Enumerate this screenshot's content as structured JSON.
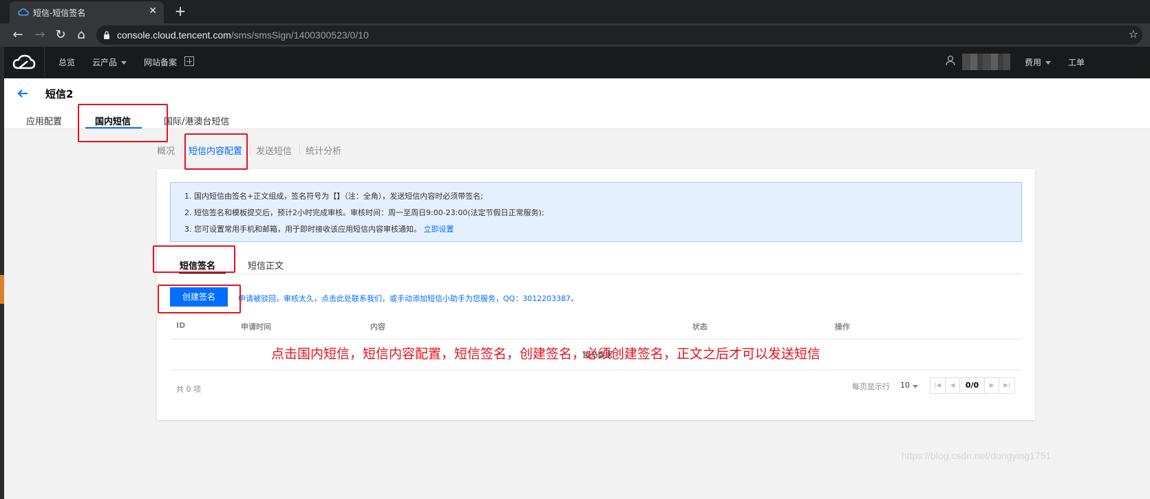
{
  "browser": {
    "tab_title": "短信-短信签名",
    "url_host": "console.cloud.tencent.com",
    "url_path": "/sms/smsSign/1400300523/0/10"
  },
  "topnav": {
    "items": [
      "总览",
      "云产品",
      "网站备案"
    ],
    "billing": "费用",
    "tickets": "工单"
  },
  "header": {
    "title": "短信2",
    "tabs": [
      "应用配置",
      "国内短信",
      "国际/港澳台短信"
    ],
    "active_tab": 1
  },
  "subnav": {
    "items": [
      "概况",
      "短信内容配置",
      "发送短信",
      "统计分析"
    ],
    "active": 1
  },
  "notice": {
    "lines": [
      "1. 国内短信由签名+正文组成，签名符号为【】（注：全角），发送短信内容时必须带签名;",
      "2. 短信签名和模板提交后，预计2小时完成审核。审核时间：周一至周日9:00-23:00(法定节假日正常服务);",
      "3. 您可设置常用手机和邮箱，用于即时接收该应用短信内容审核通知。"
    ],
    "link": "立即设置"
  },
  "content_tabs": [
    "短信签名",
    "短信正文"
  ],
  "create_button": "创建签名",
  "help_text": "申请被驳回，审核太久，点击此处联系我们，或手动添加短信小助手为您服务，QQ：3012203387。",
  "table": {
    "columns": [
      "ID",
      "申请时间",
      "内容",
      "状态",
      "操作"
    ],
    "empty_text": "暂无数据"
  },
  "pagination": {
    "total": "共 0 项",
    "page_size_label": "每页显示行",
    "page_size": "10",
    "page_indicator": "0/0"
  },
  "annotation": "点击国内短信，短信内容配置，短信签名，创建签名，必须创建签名，正文之后才可以发送短信",
  "watermark": "https://blog.csdn.net/dongying1751",
  "colors": {
    "accent": "#006eff",
    "annotation_red": "#e8101a"
  }
}
